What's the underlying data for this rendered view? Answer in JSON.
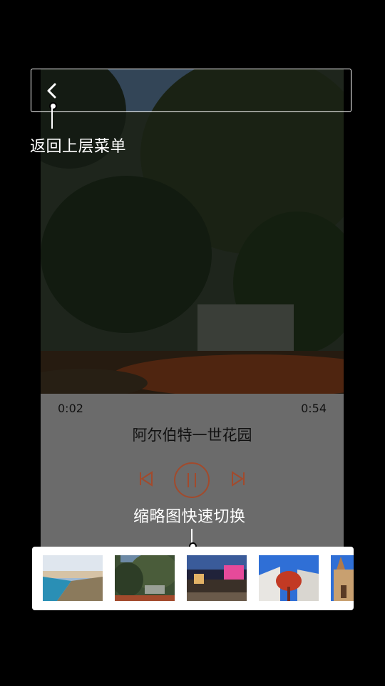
{
  "player": {
    "current_time": "0:02",
    "total_time": "0:54",
    "title": "阿尔伯特一世花园"
  },
  "annotations": {
    "back": "返回上层菜单",
    "thumbnails": "缩略图快速切换"
  },
  "icons": {
    "back": "chevron-left-icon",
    "prev": "skip-previous-icon",
    "pause": "pause-icon",
    "next": "skip-next-icon"
  },
  "colors": {
    "accent": "#a24a2c",
    "panel": "#6b6b6b"
  },
  "thumbnails": [
    {
      "name": "thumb-coastline",
      "selected": false
    },
    {
      "name": "thumb-garden",
      "selected": true
    },
    {
      "name": "thumb-night-street",
      "selected": false
    },
    {
      "name": "thumb-red-sculpture",
      "selected": false
    },
    {
      "name": "thumb-church",
      "selected": false
    }
  ]
}
